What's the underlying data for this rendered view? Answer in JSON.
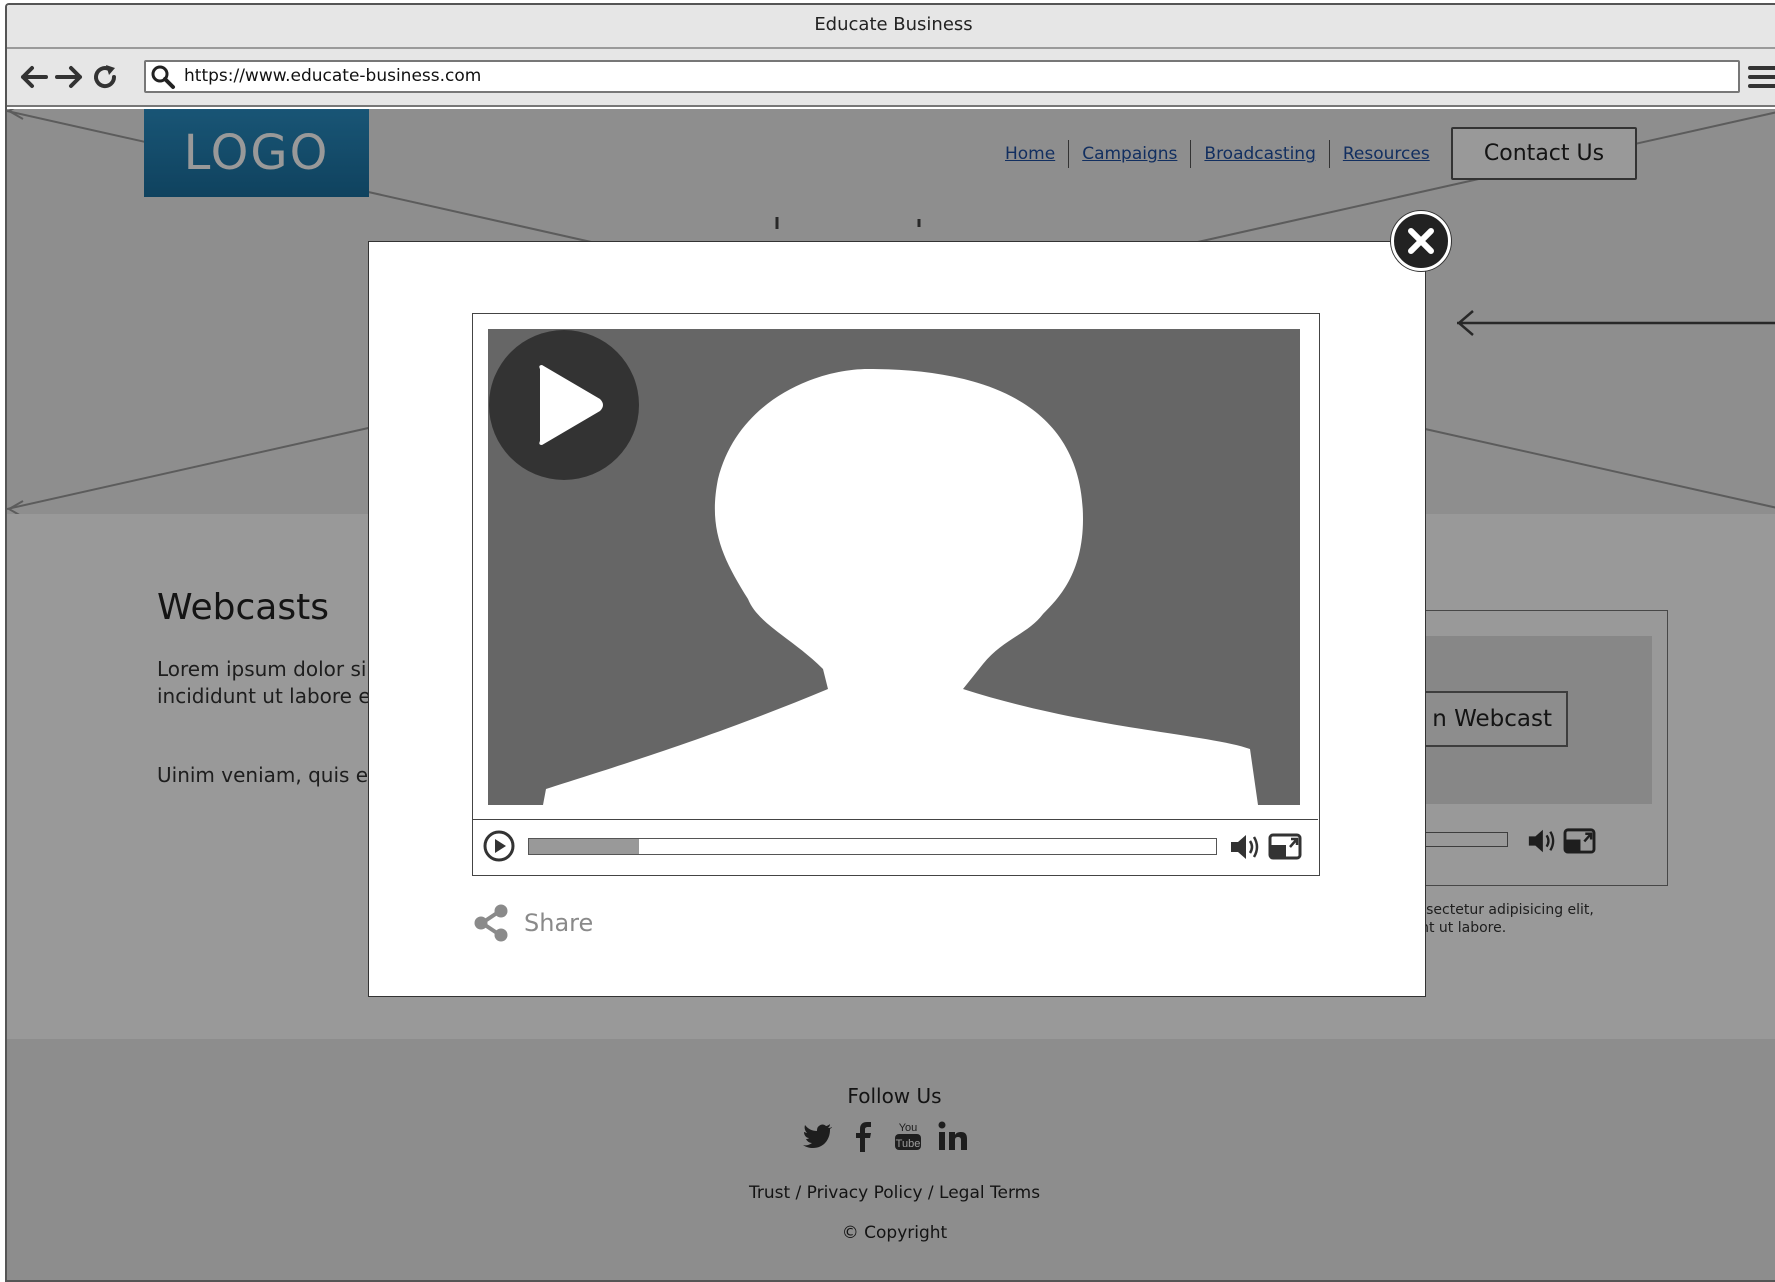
{
  "browser": {
    "title": "Educate Business",
    "url": "https://www.educate-business.com"
  },
  "header": {
    "logo": "LOGO",
    "nav": [
      "Home",
      "Campaigns",
      "Broadcasting",
      "Resources"
    ],
    "contact_label": "Contact Us"
  },
  "webcasts": {
    "heading": "Webcasts",
    "para1": "Lorem ipsum dolor si labore et dolore mag incididunt ut labore e",
    "para2": "Uinim veniam, quis e ut labore et dolore m",
    "button_label": "n Webcast",
    "caption_line1": "et, consectetur adipisicing elit,",
    "caption_line2": "cididunt ut labore."
  },
  "modal": {
    "progress_percent": 16,
    "share_label": "Share"
  },
  "footer": {
    "follow_label": "Follow Us",
    "legal": "Trust  /  Privacy Policy  /  Legal Terms",
    "copyright": "Copyright",
    "social": [
      "twitter-icon",
      "facebook-icon",
      "youtube-icon",
      "linkedin-icon"
    ]
  },
  "colors": {
    "logo_blue": "#1a6f9e",
    "link_blue": "#1f4fa0",
    "overlay": "rgba(0,0,0,0.40)"
  }
}
